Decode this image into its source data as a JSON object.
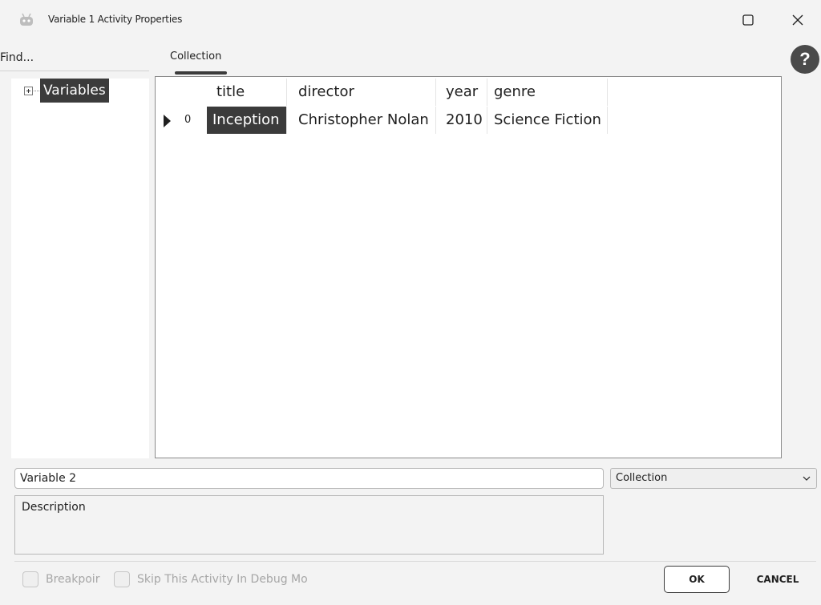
{
  "window": {
    "title": "Variable 1 Activity Properties",
    "app_icon": "robot-icon",
    "maximize_icon": "maximize-icon",
    "close_icon": "close-icon"
  },
  "find": {
    "label": "Find..."
  },
  "tabs": [
    {
      "label": "Collection",
      "active": true
    }
  ],
  "help": {
    "label": "?"
  },
  "tree": {
    "items": [
      {
        "label": "Variables",
        "expanded": false,
        "selected": true
      }
    ]
  },
  "grid": {
    "columns": [
      "title",
      "director",
      "year",
      "genre"
    ],
    "rows": [
      {
        "index": "0",
        "cells": [
          "Inception",
          "Christopher Nolan",
          "2010",
          "Science Fiction"
        ]
      }
    ]
  },
  "form": {
    "name_value": "Variable 2",
    "type_value": "Collection",
    "description_value": "Description"
  },
  "footer": {
    "breakpoint_label": "Breakpoir",
    "skip_label": "Skip This Activity In Debug Mo",
    "ok_label": "OK",
    "cancel_label": "CANCEL"
  },
  "colors": {
    "accent": "#3b3b3b",
    "background": "#f3f3f3"
  }
}
